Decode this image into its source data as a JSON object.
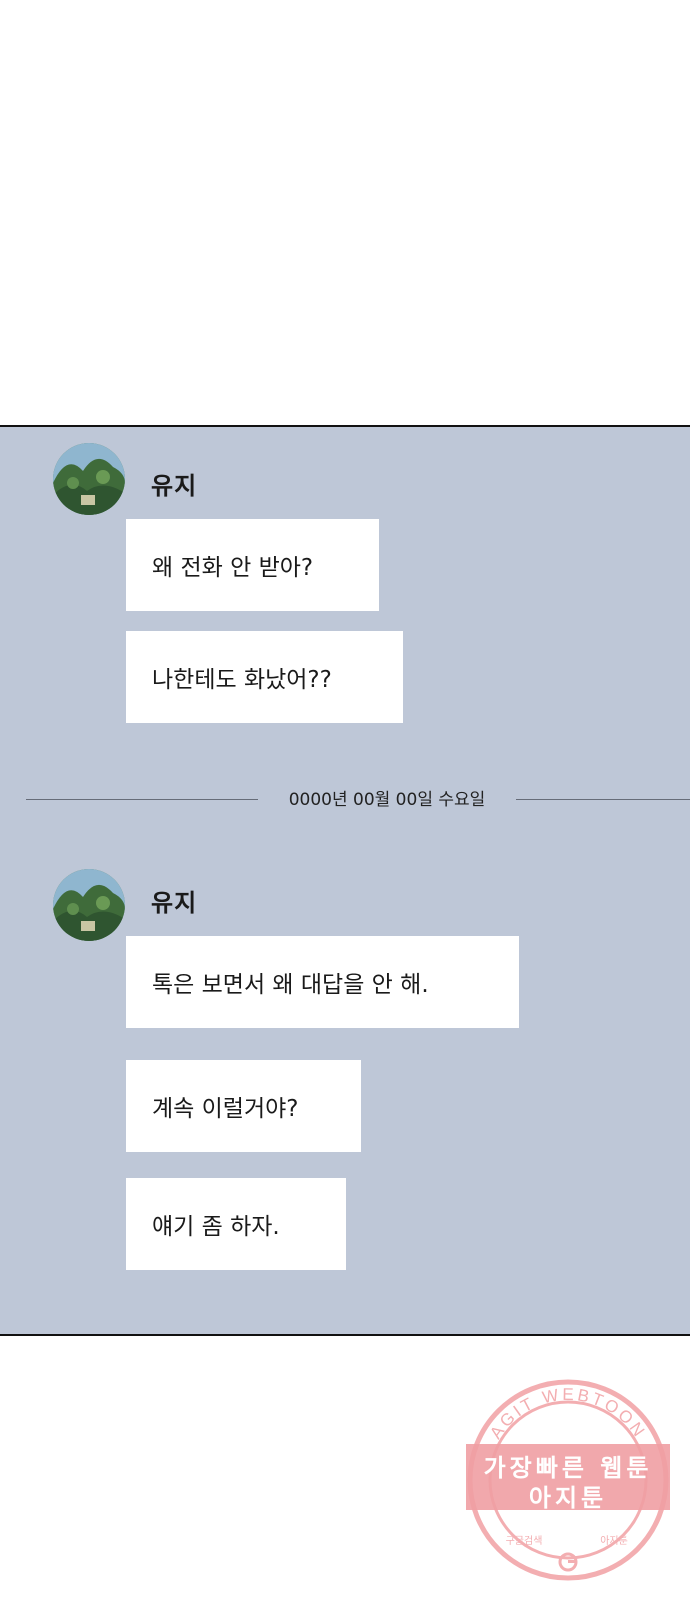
{
  "chat": {
    "block1": {
      "sender": "유지",
      "messages": [
        "왜 전화 안 받아?",
        "나한테도 화났어??"
      ]
    },
    "date_separator": "0000년 00월 00일 수요일",
    "block2": {
      "sender": "유지",
      "messages": [
        "톡은 보면서 왜 대답을 안 해.",
        "계속 이럴거야?",
        "얘기 좀 하자."
      ]
    }
  },
  "watermark": {
    "arc_text": "AGIT WEBTOON",
    "line1": "가장빠른 웹툰",
    "line2": "아지툰",
    "small_left": "구글검색",
    "small_right": "아지툰",
    "icon": "google-g-icon"
  },
  "colors": {
    "chat_background": "#bec7d7",
    "bubble": "#ffffff",
    "watermark": "#f0a0a4"
  }
}
